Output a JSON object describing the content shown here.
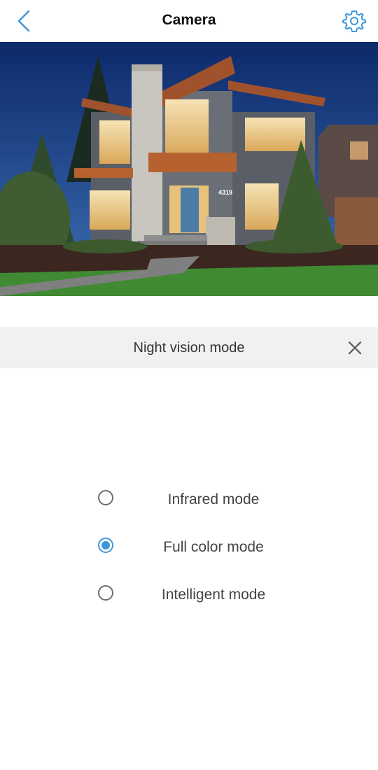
{
  "header": {
    "title": "Camera",
    "back_icon": "chevron-left-icon",
    "settings_icon": "gear-icon"
  },
  "preview": {
    "house_number": "4319"
  },
  "night_vision": {
    "title": "Night vision mode",
    "close_icon": "close-icon",
    "options": [
      {
        "label": "Infrared mode",
        "selected": false
      },
      {
        "label": "Full color mode",
        "selected": true
      },
      {
        "label": "Intelligent mode",
        "selected": false
      }
    ]
  },
  "colors": {
    "accent": "#3e97dc",
    "sheet_header_bg": "#f1f1f1"
  }
}
